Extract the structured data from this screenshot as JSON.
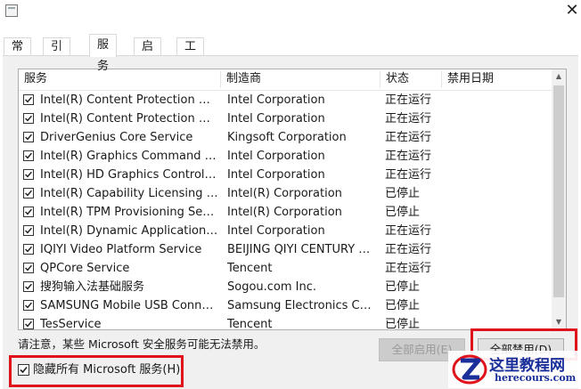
{
  "window": {
    "tabs": [
      {
        "label": "常规",
        "active": false
      },
      {
        "label": "引导",
        "active": false
      },
      {
        "label": "服务",
        "active": true
      },
      {
        "label": "启动",
        "active": false
      },
      {
        "label": "工具",
        "active": false
      }
    ],
    "close_glyph": "✕"
  },
  "services": {
    "columns": {
      "service": "服务",
      "manufacturer": "制造商",
      "status": "状态",
      "disabled_date": "禁用日期"
    },
    "rows": [
      {
        "name": "Intel(R) Content Protection HECI ...",
        "manufacturer": "Intel Corporation",
        "status": "正在运行",
        "checked": true
      },
      {
        "name": "Intel(R) Content Protection HDCP...",
        "manufacturer": "Intel Corporation",
        "status": "正在运行",
        "checked": true
      },
      {
        "name": "DriverGenius Core Service",
        "manufacturer": "Kingsoft Corporation",
        "status": "正在运行",
        "checked": true
      },
      {
        "name": "Intel(R) Graphics Command Cent...",
        "manufacturer": "Intel Corporation",
        "status": "正在运行",
        "checked": true
      },
      {
        "name": "Intel(R) HD Graphics Control Pan...",
        "manufacturer": "Intel Corporation",
        "status": "正在运行",
        "checked": true
      },
      {
        "name": "Intel(R) Capability Licensing Servi...",
        "manufacturer": "Intel(R) Corporation",
        "status": "已停止",
        "checked": true
      },
      {
        "name": "Intel(R) TPM Provisioning Service",
        "manufacturer": "Intel(R) Corporation",
        "status": "已停止",
        "checked": true
      },
      {
        "name": "Intel(R) Dynamic Application Loa...",
        "manufacturer": "Intel Corporation",
        "status": "正在运行",
        "checked": true
      },
      {
        "name": "IQIYI Video Platform Service",
        "manufacturer": "BEIJING QIYI CENTURY SC...",
        "status": "正在运行",
        "checked": true
      },
      {
        "name": "QPCore Service",
        "manufacturer": "Tencent",
        "status": "正在运行",
        "checked": true
      },
      {
        "name": "搜狗输入法基础服务",
        "manufacturer": "Sogou.com Inc.",
        "status": "已停止",
        "checked": true
      },
      {
        "name": "SAMSUNG Mobile USB Connecti...",
        "manufacturer": "Samsung Electronics Co., L...",
        "status": "已停止",
        "checked": true
      },
      {
        "name": "TesService",
        "manufacturer": "Tencent",
        "status": "已停止",
        "checked": true
      }
    ]
  },
  "notice": "请注意，某些 Microsoft 安全服务可能无法禁用。",
  "buttons": {
    "enable_all": "全部启用(E)",
    "disable_all": "全部禁用(D)"
  },
  "hide_microsoft": {
    "label": "隐藏所有 Microsoft 服务(H)",
    "checked": true
  },
  "watermark": {
    "title": "这里教程网",
    "url": "herecours.com"
  },
  "colors": {
    "highlight_red": "#e0121b",
    "watermark_blue": "#1a2f9a"
  }
}
